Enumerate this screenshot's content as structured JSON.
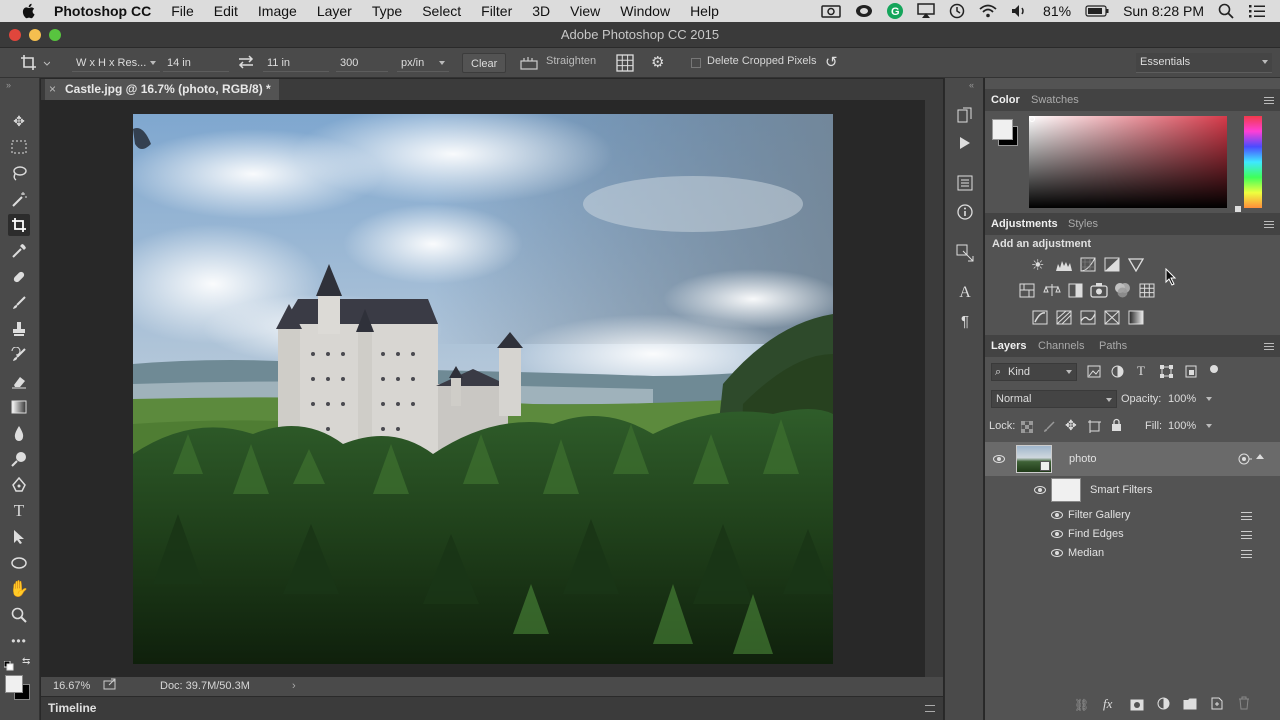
{
  "menubar": {
    "app_name": "Photoshop CC",
    "items": [
      "File",
      "Edit",
      "Image",
      "Layer",
      "Type",
      "Select",
      "Filter",
      "3D",
      "View",
      "Window",
      "Help"
    ],
    "battery": "81%",
    "clock": "Sun 8:28 PM"
  },
  "window": {
    "title": "Adobe Photoshop CC 2015"
  },
  "options": {
    "ratio_preset": "W x H x Res...",
    "width": "14 in",
    "height": "11 in",
    "resolution": "300",
    "res_unit": "px/in",
    "clear_label": "Clear",
    "straighten_label": "Straighten",
    "delete_cropped_label": "Delete Cropped Pixels",
    "workspace": "Essentials"
  },
  "document": {
    "tab_title": "Castle.jpg @ 16.7% (photo, RGB/8) *"
  },
  "status": {
    "zoom": "16.67%",
    "doc_size": "Doc: 39.7M/50.3M"
  },
  "timeline": {
    "label": "Timeline"
  },
  "color_panel": {
    "tabs": [
      "Color",
      "Swatches"
    ],
    "foreground": "#f0f0f0",
    "background": "#000000"
  },
  "adjustments_panel": {
    "tabs": [
      "Adjustments",
      "Styles"
    ],
    "hint": "Add an adjustment"
  },
  "layers_panel": {
    "tabs": [
      "Layers",
      "Channels",
      "Paths"
    ],
    "filter_kind": "Kind",
    "blend_mode": "Normal",
    "opacity_label": "Opacity:",
    "opacity_value": "100%",
    "lock_label": "Lock:",
    "fill_label": "Fill:",
    "fill_value": "100%",
    "layer_name": "photo",
    "smart_filters_label": "Smart Filters",
    "filters": [
      "Filter Gallery",
      "Find Edges",
      "Median"
    ]
  },
  "colors": {
    "accent_red": "#e0463c",
    "traffic_yellow": "#f5bf4f",
    "traffic_green": "#58c43f"
  }
}
